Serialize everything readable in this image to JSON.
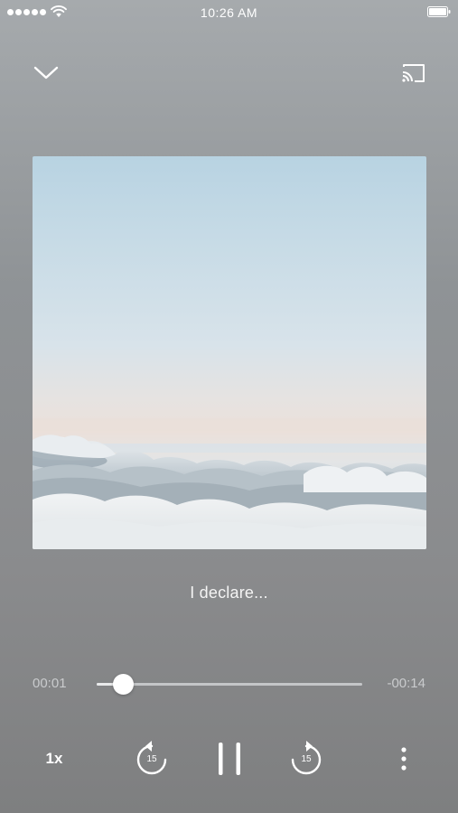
{
  "status_bar": {
    "time": "10:26 AM",
    "signal_bars": 5,
    "icons": [
      "signal-dots",
      "wifi-icon",
      "battery-icon"
    ]
  },
  "header": {
    "collapse_icon": "chevron-down-icon",
    "cast_icon": "cast-icon"
  },
  "track": {
    "title": "I declare...",
    "artwork": "sky-above-clouds"
  },
  "progress": {
    "elapsed": "00:01",
    "remaining": "-00:14",
    "fraction": 0.1
  },
  "controls": {
    "speed_label": "1x",
    "skip_back_seconds": "15",
    "skip_forward_seconds": "15",
    "play_state": "playing",
    "icons": [
      "rewind-15-icon",
      "pause-icon",
      "forward-15-icon",
      "more-vertical-icon"
    ]
  },
  "colors": {
    "background_top": "#a6aaad",
    "background_bottom": "#7e7f80",
    "foreground": "#ffffff",
    "muted_text": "#c9cbcd"
  }
}
